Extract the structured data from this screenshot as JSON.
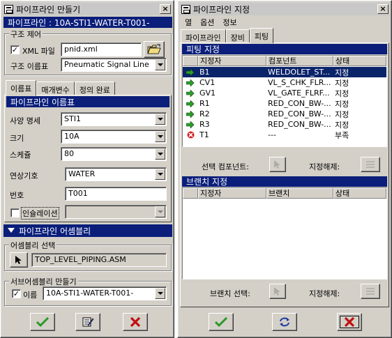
{
  "left_window": {
    "title": "파이프라인 만들기",
    "close": "×",
    "pipeline_banner": "파이프라인 : 10A-STI1-WATER-T001-",
    "structure_control": {
      "legend": "구조 제어",
      "xml_file_label": "XML 파일",
      "xml_file_checked": true,
      "xml_file_value": "pnid.xml",
      "structure_name_label": "구조 이름표",
      "structure_name_value": "Pneumatic Signal Line"
    },
    "tabs": [
      "이름표",
      "매개변수",
      "정의 완료"
    ],
    "pipeline_name_banner": "파이프라인 이름표",
    "fields": [
      {
        "label": "사양 명세",
        "value": "STI1"
      },
      {
        "label": "크기",
        "value": "10A"
      },
      {
        "label": "스케쥴",
        "value": "80"
      },
      {
        "label": "연상기호",
        "value": "WATER"
      },
      {
        "label": "번호",
        "value": "T001"
      }
    ],
    "insulation_label": "인슐레이션",
    "insulation_checked": false,
    "assembly_banner": "파이프라인 어셈블리",
    "assembly_select": {
      "legend": "어셈블리 선택",
      "value": "TOP_LEVEL_PIPING.ASM"
    },
    "sub_assembly": {
      "legend": "서브어셈블리 만들기",
      "name_label": "이름",
      "name_checked": true,
      "name_value": "10A-STI1-WATER-T001-"
    }
  },
  "right_window": {
    "title": "파이프라인 지정",
    "close": "×",
    "menu": [
      "열",
      "옵션",
      "정보"
    ],
    "tabs": [
      "파이프라인",
      "장비",
      "피팅"
    ],
    "fitting_banner": "피팅 지정",
    "fitting_columns": [
      "지정자",
      "컴포넌트",
      "상태"
    ],
    "fittings": [
      {
        "icon": "green-arrow",
        "designator": "B1",
        "component": "WELDOLET_ST...",
        "status": "지정",
        "selected": true
      },
      {
        "icon": "green-arrow",
        "designator": "CV1",
        "component": "VL_S_CHK_FLR...",
        "status": "지정",
        "selected": false
      },
      {
        "icon": "green-arrow",
        "designator": "GV1",
        "component": "VL_GATE_FLRF...",
        "status": "지정",
        "selected": false
      },
      {
        "icon": "green-arrow",
        "designator": "R1",
        "component": "RED_CON_BW-...",
        "status": "지정",
        "selected": false
      },
      {
        "icon": "green-arrow",
        "designator": "R2",
        "component": "RED_CON_BW-...",
        "status": "지정",
        "selected": false
      },
      {
        "icon": "green-arrow",
        "designator": "R3",
        "component": "RED_CON_BW-...",
        "status": "지정",
        "selected": false
      },
      {
        "icon": "red-x",
        "designator": "T1",
        "component": "---",
        "status": "부족",
        "selected": false
      }
    ],
    "select_component_label": "선택 컴포넌트:",
    "unassign_label": "지정해제:",
    "branch_banner": "브랜치 지정",
    "branch_columns": [
      "지정자",
      "브랜치",
      "상태"
    ],
    "select_branch_label": "브랜치 선택:",
    "branch_unassign_label": "지정해제:"
  },
  "colors": {
    "banner": "#0a1e7a",
    "selection": "#0a246a",
    "ok_green": "#2a9a2a",
    "cancel_red": "#c01010"
  }
}
